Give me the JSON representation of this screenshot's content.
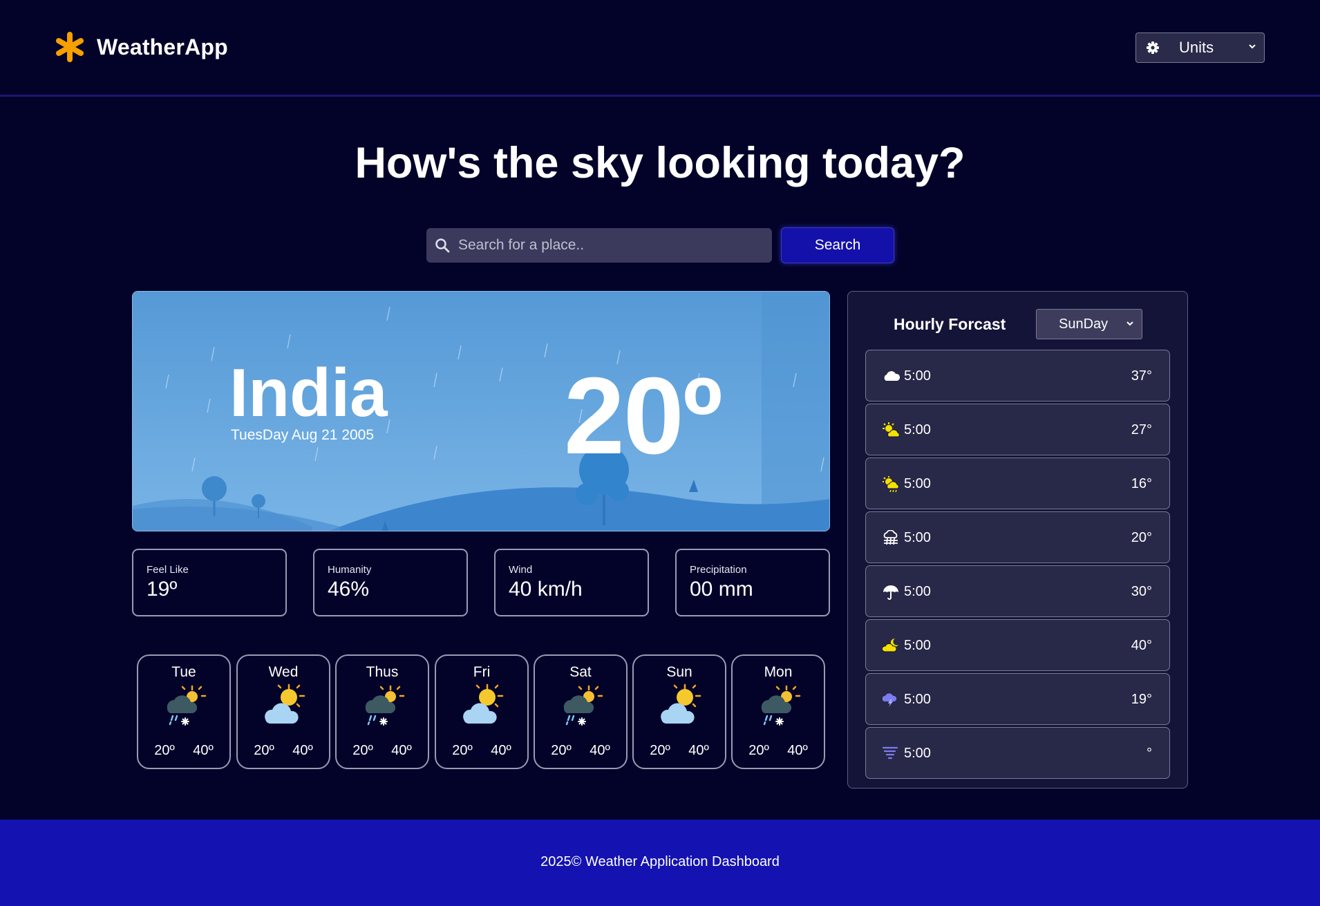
{
  "app": {
    "name": "WeatherApp"
  },
  "header": {
    "units_label": "Units"
  },
  "hero": {
    "title": "How's the sky looking today?",
    "search_placeholder": "Search for a place..",
    "search_button": "Search"
  },
  "current": {
    "location": "India",
    "date": "TuesDay Aug 21 2005",
    "temperature": "20º"
  },
  "stats": [
    {
      "label": "Feel Like",
      "value": "19º"
    },
    {
      "label": "Humanity",
      "value": "46%"
    },
    {
      "label": "Wind",
      "value": "40 km/h"
    },
    {
      "label": "Precipitation",
      "value": "00 mm"
    }
  ],
  "daily": [
    {
      "day": "Tue",
      "icon": "snow-sun-icon",
      "low": "20º",
      "high": "40º"
    },
    {
      "day": "Wed",
      "icon": "partly-cloudy-icon",
      "low": "20º",
      "high": "40º"
    },
    {
      "day": "Thus",
      "icon": "snow-sun-icon",
      "low": "20º",
      "high": "40º"
    },
    {
      "day": "Fri",
      "icon": "partly-cloudy-icon",
      "low": "20º",
      "high": "40º"
    },
    {
      "day": "Sat",
      "icon": "snow-sun-icon",
      "low": "20º",
      "high": "40º"
    },
    {
      "day": "Sun",
      "icon": "partly-cloudy-icon",
      "low": "20º",
      "high": "40º"
    },
    {
      "day": "Mon",
      "icon": "snow-sun-icon",
      "low": "20º",
      "high": "40º"
    }
  ],
  "hourly": {
    "title": "Hourly Forcast",
    "selected_day": "SunDay",
    "items": [
      {
        "icon": "cloud-icon",
        "time": "5:00",
        "temp": "37°",
        "color": "#ffffff"
      },
      {
        "icon": "sun-cloud-icon",
        "time": "5:00",
        "temp": "27°",
        "color": "#f5e100"
      },
      {
        "icon": "sun-rain-cloud-icon",
        "time": "5:00",
        "temp": "16°",
        "color": "#f5e100"
      },
      {
        "icon": "hail-icon",
        "time": "5:00",
        "temp": "20°",
        "color": "#ffffff"
      },
      {
        "icon": "umbrella-icon",
        "time": "5:00",
        "temp": "30°",
        "color": "#ffffff"
      },
      {
        "icon": "moon-cloud-icon",
        "time": "5:00",
        "temp": "40°",
        "color": "#f5e100"
      },
      {
        "icon": "storm-cloud-icon",
        "time": "5:00",
        "temp": "19°",
        "color": "#7c7cf0"
      },
      {
        "icon": "tornado-icon",
        "time": "5:00",
        "temp": "°",
        "color": "#7c7cf0"
      }
    ]
  },
  "footer": {
    "text": "2025© Weather Application Dashboard"
  },
  "colors": {
    "background": "#03032a",
    "accent": "#1410aa",
    "logo": "#f5a000",
    "card_sky": "#5aa0dc"
  }
}
